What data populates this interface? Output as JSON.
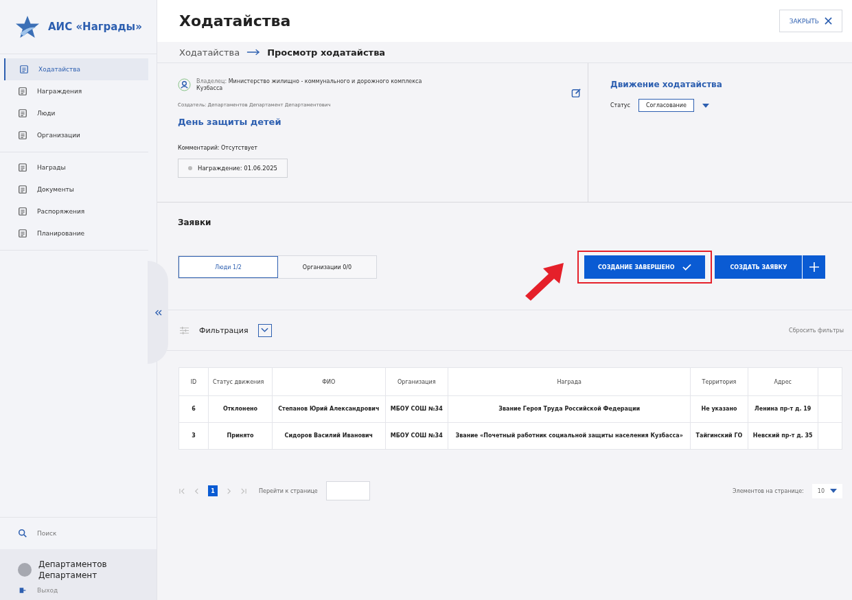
{
  "sidebar": {
    "logo": "АИС «Награды»",
    "groups": [
      [
        {
          "label": "Ходатайства",
          "selected": true
        },
        {
          "label": "Награждения",
          "selected": false
        },
        {
          "label": "Люди",
          "selected": false
        },
        {
          "label": "Организации",
          "selected": false
        }
      ],
      [
        {
          "label": "Награды",
          "selected": false
        },
        {
          "label": "Документы",
          "selected": false
        },
        {
          "label": "Распоряжения",
          "selected": false
        },
        {
          "label": "Планирование",
          "selected": false
        }
      ]
    ],
    "search": "Поиск",
    "user": "Департаментов Департамент",
    "logout": "Выход"
  },
  "header": {
    "title": "Ходатайства",
    "close": "ЗАКРЫТЬ"
  },
  "breadcrumbs": [
    "Ходатайства",
    "Просмотр ходатайства"
  ],
  "petition": {
    "owner_label": "Владелец:",
    "owner": "Министерство жилищно - коммунального и дорожного комплекса Кузбасса",
    "creator": "Создатель: Департаментов Департамент Департаментович",
    "name": "День защиты детей",
    "comment": "Комментарий: Отсутствует",
    "award_date": "Награждение: 01.06.2025"
  },
  "movement": {
    "title": "Движение ходатайства",
    "status_label": "Статус",
    "status": "Согласование"
  },
  "applications": {
    "title": "Заявки",
    "tabs": [
      {
        "label": "Люди 1/2",
        "selected": true
      },
      {
        "label": "Организации 0/0",
        "selected": false
      }
    ],
    "complete_button": "СОЗДАНИЕ ЗАВЕРШЕНО",
    "create_button": "СОЗДАТЬ ЗАЯВКУ",
    "filter": "Фильтрация",
    "reset_filters": "Сбросить фильтры"
  },
  "table": {
    "columns": [
      "ID",
      "Статус движения",
      "ФИО",
      "Организация",
      "Награда",
      "Территория",
      "Адрес"
    ],
    "rows": [
      [
        "6",
        "Отклонено",
        "Степанов Юрий Александрович",
        "МБОУ СОШ №34",
        "Звание Героя Труда Российской Федерации",
        "Не указано",
        "Ленина пр-т д. 19"
      ],
      [
        "3",
        "Принято",
        "Сидоров Василий Иванович",
        "МБОУ СОШ №34",
        "Звание «Почетный работник социальной защиты населения Кузбасса»",
        "Тайгинский ГО",
        "Невский пр-т д. 35"
      ]
    ]
  },
  "pagination": {
    "pages": [
      {
        "label": "1",
        "selected": true
      }
    ],
    "goto_label": "Перейти к странице",
    "per_page_label": "Элементов на странице:",
    "per_page": "10"
  }
}
